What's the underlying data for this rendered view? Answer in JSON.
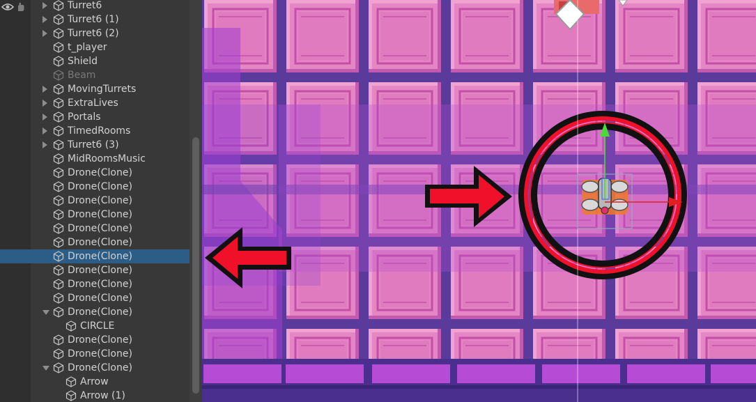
{
  "hierarchy": {
    "items": [
      {
        "label": "Turret6",
        "indent": 0,
        "foldout": "closed",
        "dim": false,
        "selected": false
      },
      {
        "label": "Turret6 (1)",
        "indent": 0,
        "foldout": "closed",
        "dim": false,
        "selected": false
      },
      {
        "label": "Turret6 (2)",
        "indent": 0,
        "foldout": "closed",
        "dim": false,
        "selected": false
      },
      {
        "label": "t_player",
        "indent": 0,
        "foldout": "none",
        "dim": false,
        "selected": false
      },
      {
        "label": "Shield",
        "indent": 0,
        "foldout": "none",
        "dim": false,
        "selected": false
      },
      {
        "label": "Beam",
        "indent": 0,
        "foldout": "none",
        "dim": true,
        "selected": false
      },
      {
        "label": "MovingTurrets",
        "indent": 0,
        "foldout": "closed",
        "dim": false,
        "selected": false
      },
      {
        "label": "ExtraLives",
        "indent": 0,
        "foldout": "closed",
        "dim": false,
        "selected": false
      },
      {
        "label": "Portals",
        "indent": 0,
        "foldout": "closed",
        "dim": false,
        "selected": false
      },
      {
        "label": "TimedRooms",
        "indent": 0,
        "foldout": "closed",
        "dim": false,
        "selected": false
      },
      {
        "label": "Turret6 (3)",
        "indent": 0,
        "foldout": "closed",
        "dim": false,
        "selected": false
      },
      {
        "label": "MidRoomsMusic",
        "indent": 0,
        "foldout": "none",
        "dim": false,
        "selected": false
      },
      {
        "label": "Drone(Clone)",
        "indent": 0,
        "foldout": "none",
        "dim": false,
        "selected": false
      },
      {
        "label": "Drone(Clone)",
        "indent": 0,
        "foldout": "none",
        "dim": false,
        "selected": false
      },
      {
        "label": "Drone(Clone)",
        "indent": 0,
        "foldout": "none",
        "dim": false,
        "selected": false
      },
      {
        "label": "Drone(Clone)",
        "indent": 0,
        "foldout": "none",
        "dim": false,
        "selected": false
      },
      {
        "label": "Drone(Clone)",
        "indent": 0,
        "foldout": "none",
        "dim": false,
        "selected": false
      },
      {
        "label": "Drone(Clone)",
        "indent": 0,
        "foldout": "none",
        "dim": false,
        "selected": false
      },
      {
        "label": "Drone(Clone)",
        "indent": 0,
        "foldout": "none",
        "dim": false,
        "selected": true
      },
      {
        "label": "Drone(Clone)",
        "indent": 0,
        "foldout": "none",
        "dim": false,
        "selected": false
      },
      {
        "label": "Drone(Clone)",
        "indent": 0,
        "foldout": "none",
        "dim": false,
        "selected": false
      },
      {
        "label": "Drone(Clone)",
        "indent": 0,
        "foldout": "none",
        "dim": false,
        "selected": false
      },
      {
        "label": "Drone(Clone)",
        "indent": 0,
        "foldout": "open",
        "dim": false,
        "selected": false
      },
      {
        "label": "CIRCLE",
        "indent": 1,
        "foldout": "none",
        "dim": false,
        "selected": false
      },
      {
        "label": "Drone(Clone)",
        "indent": 0,
        "foldout": "none",
        "dim": false,
        "selected": false
      },
      {
        "label": "Drone(Clone)",
        "indent": 0,
        "foldout": "none",
        "dim": false,
        "selected": false
      },
      {
        "label": "Drone(Clone)",
        "indent": 0,
        "foldout": "open",
        "dim": false,
        "selected": false
      },
      {
        "label": "Arrow",
        "indent": 1,
        "foldout": "none",
        "dim": false,
        "selected": false
      },
      {
        "label": "Arrow (1)",
        "indent": 1,
        "foldout": "none",
        "dim": false,
        "selected": false
      }
    ]
  },
  "icons": {
    "visibility": "eye-icon",
    "pickability": "hand-icon",
    "gameobject": "cube-icon",
    "foldout": "triangle-icon"
  },
  "colors": {
    "panel_bg": "#383838",
    "selection": "#2c5d87",
    "text": "#d2d2d2",
    "text_disabled": "#7a7a7a",
    "scene_tile_pink": "#e06ec3",
    "scene_tile_purple": "#b54fd0",
    "scene_grout": "#5a3b9c",
    "arrow_red": "#f0102a",
    "gizmo_green": "#4cd93a",
    "gizmo_red": "#e02020"
  }
}
